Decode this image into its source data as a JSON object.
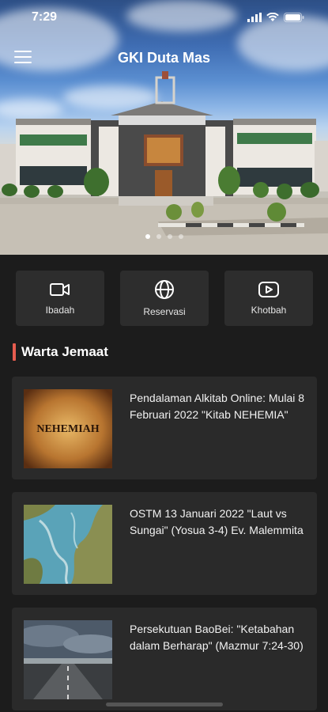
{
  "status": {
    "time": "7:29"
  },
  "header": {
    "title": "GKI Duta Mas"
  },
  "carousel": {
    "count": 4,
    "active": 0
  },
  "actions": [
    {
      "label": "Ibadah",
      "icon": "video-camera-icon"
    },
    {
      "label": "Reservasi",
      "icon": "globe-icon"
    },
    {
      "label": "Khotbah",
      "icon": "play-button-icon"
    }
  ],
  "section": {
    "title": "Warta Jemaat"
  },
  "news": [
    {
      "title": "Pendalaman Alkitab Online: Mulai 8 Februari 2022 \"Kitab NEHEMIA\"",
      "thumb_text": "NEHEMIAH"
    },
    {
      "title": "OSTM 13 Januari 2022 \"Laut vs Sungai\" (Yosua 3-4) Ev. Malemmita",
      "thumb_text": ""
    },
    {
      "title": "Persekutuan BaoBei: \"Ketabahan dalam Berharap\"  (Mazmur 7:24-30)",
      "thumb_text": ""
    }
  ],
  "colors": {
    "accent": "#e65c4f",
    "background": "#1c1c1c",
    "card": "#2a2a2a",
    "action": "#2d2d2d"
  }
}
